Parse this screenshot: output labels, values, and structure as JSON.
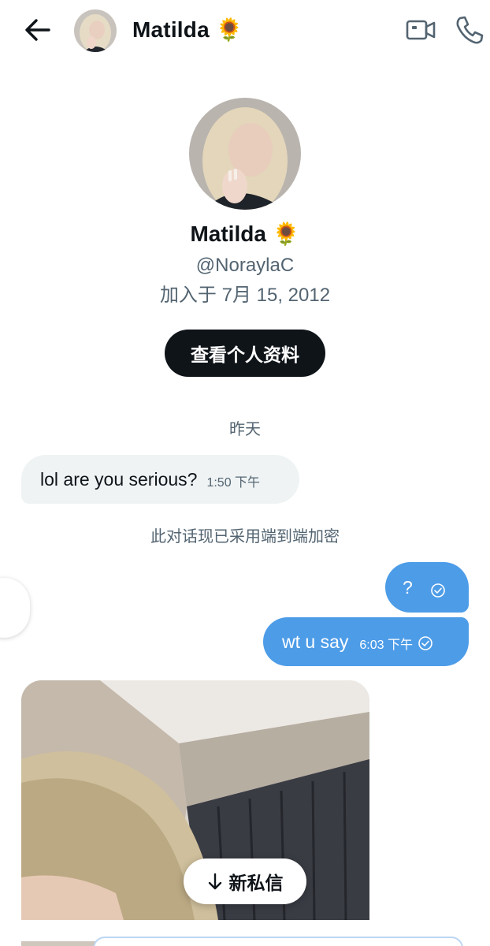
{
  "header": {
    "back_icon": "arrow-left-icon",
    "name": "Matilda 🌻",
    "video_icon": "video-camera-icon",
    "call_icon": "phone-icon"
  },
  "profile": {
    "name": "Matilda 🌻",
    "handle": "@NoraylaC",
    "joined": "加入于 7月 15, 2012",
    "view_profile_label": "查看个人资料"
  },
  "conversation": {
    "date_separator": "昨天",
    "incoming": [
      {
        "text": "lol are you serious?",
        "time": "1:50 下午"
      }
    ],
    "encryption_note": "此对话现已采用端到端加密",
    "outgoing": [
      {
        "text": "?",
        "time": "",
        "status_icon": "sent-check-icon"
      },
      {
        "text": "wt u say",
        "time": "6:03 下午",
        "status_icon": "sent-check-icon"
      }
    ]
  },
  "new_messages_pill": {
    "icon": "arrow-down-icon",
    "label": "新私信"
  },
  "colors": {
    "accent_bubble": "#4d9ce8",
    "incoming_bubble": "#eff3f4",
    "primary_button": "#0f1419",
    "secondary_text": "#536471"
  }
}
